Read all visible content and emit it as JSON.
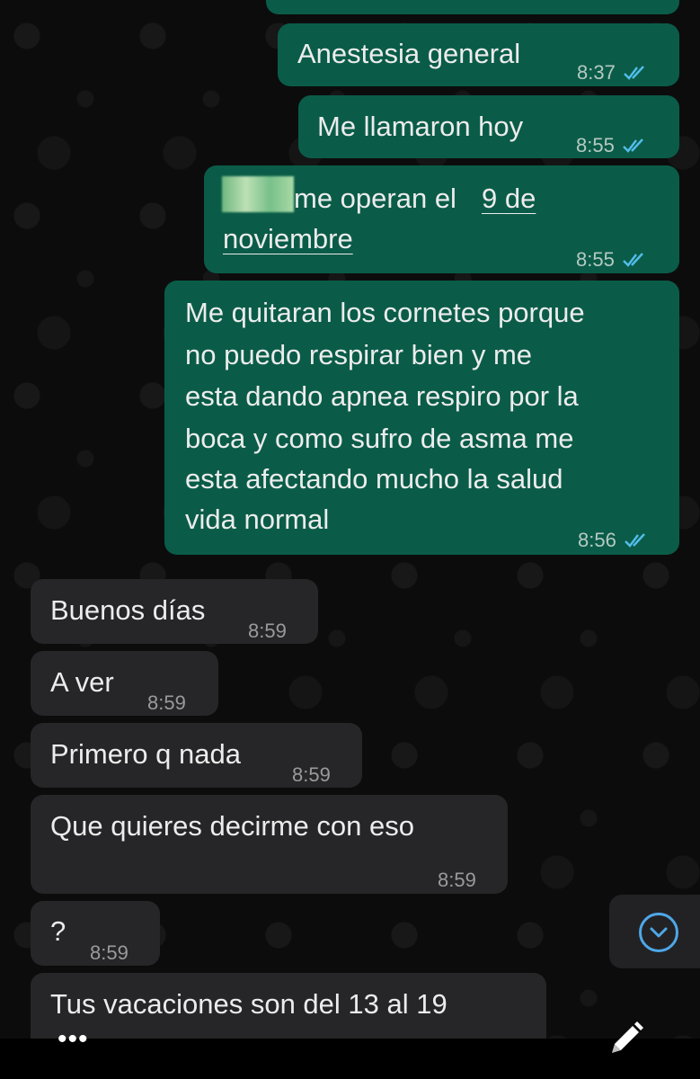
{
  "messages": [
    {
      "id": "m1",
      "dir": "out",
      "text": "Anestesia general",
      "time": "8:37",
      "read": true
    },
    {
      "id": "m2",
      "dir": "out",
      "text": "Me llamaron hoy",
      "time": "8:55",
      "read": true
    },
    {
      "id": "m3",
      "dir": "out",
      "text_line1": "me operan el",
      "link_part1": "9 de",
      "link_part2": "noviembre",
      "time": "8:55",
      "read": true
    },
    {
      "id": "m4",
      "dir": "out",
      "lines": [
        "Me quitaran los cornetes porque",
        "no puedo respirar  bien y me",
        "esta dando apnea respiro por la",
        "boca y como sufro de asma me",
        "esta afectando mucho la salud",
        "vida normal"
      ],
      "time": "8:56",
      "read": true
    },
    {
      "id": "m5",
      "dir": "in",
      "text": "Buenos días",
      "time": "8:59"
    },
    {
      "id": "m6",
      "dir": "in",
      "text": "A ver",
      "time": "8:59"
    },
    {
      "id": "m7",
      "dir": "in",
      "text": "Primero q nada",
      "time": "8:59"
    },
    {
      "id": "m8",
      "dir": "in",
      "text": "Que quieres decirme con eso",
      "time": "8:59"
    },
    {
      "id": "m9",
      "dir": "in",
      "text": "?",
      "time": "8:59"
    },
    {
      "id": "m10",
      "dir": "in",
      "text": "Tus vacaciones son del 13 al 19",
      "time": ""
    }
  ],
  "scroll_down_icon": "chevron-down-circle-icon",
  "bottom": {
    "more_label": "•••",
    "compose_icon": "pencil-icon"
  },
  "colors": {
    "outgoing_bubble": "#0a5c48",
    "incoming_bubble": "#262628",
    "read_ticks": "#53bdeb",
    "background": "#0b0b0b"
  }
}
